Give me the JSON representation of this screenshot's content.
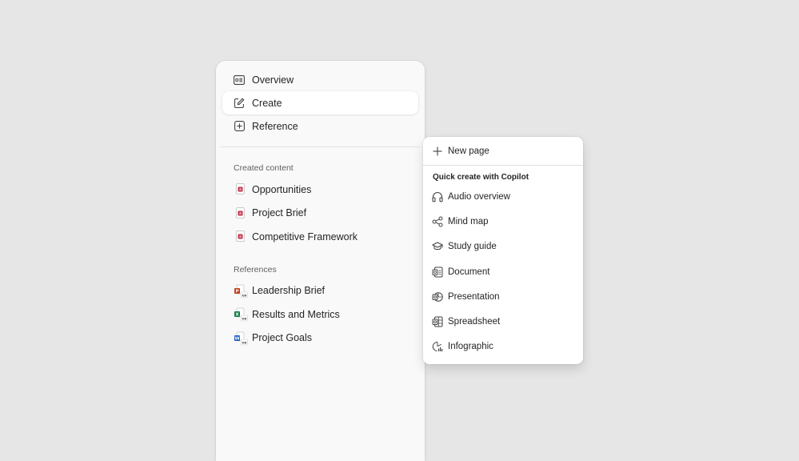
{
  "nav": {
    "top_items": [
      {
        "label": "Overview",
        "icon": "overview-icon",
        "selected": false
      },
      {
        "label": "Create",
        "icon": "edit-icon",
        "selected": true
      },
      {
        "label": "Reference",
        "icon": "add-square-icon",
        "selected": false
      }
    ],
    "created_section_label": "Created content",
    "created_items": [
      {
        "label": "Opportunities",
        "icon": "page-icon"
      },
      {
        "label": "Project Brief",
        "icon": "page-icon"
      },
      {
        "label": "Competitive Framework",
        "icon": "page-icon"
      }
    ],
    "references_section_label": "References",
    "reference_items": [
      {
        "label": "Leadership Brief",
        "icon": "powerpoint-file-icon",
        "color": "#c43e1c"
      },
      {
        "label": "Results and Metrics",
        "icon": "excel-file-icon",
        "color": "#107c41"
      },
      {
        "label": "Project Goals",
        "icon": "word-file-icon",
        "color": "#185abd"
      }
    ]
  },
  "menu": {
    "new_page_label": "New page",
    "quick_create_header": "Quick create with Copilot",
    "items": [
      {
        "label": "Audio overview",
        "icon": "headphones-icon"
      },
      {
        "label": "Mind map",
        "icon": "mind-map-icon"
      },
      {
        "label": "Study guide",
        "icon": "graduation-cap-icon"
      },
      {
        "label": "Document",
        "icon": "copilot-document-icon"
      },
      {
        "label": "Presentation",
        "icon": "copilot-presentation-icon"
      },
      {
        "label": "Spreadsheet",
        "icon": "copilot-spreadsheet-icon"
      },
      {
        "label": "Infographic",
        "icon": "infographic-icon"
      }
    ]
  },
  "colors": {
    "background": "#e6e6e6",
    "panel": "#f9f9f9",
    "page_icon_accent": "#c4314b"
  }
}
